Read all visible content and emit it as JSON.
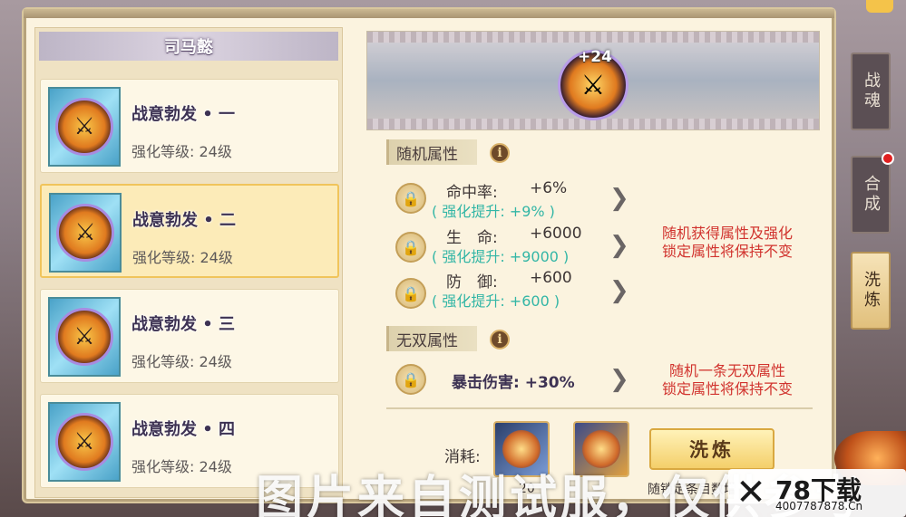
{
  "hero_name": "司马懿",
  "cards": [
    {
      "title": "战意勃发 • 一",
      "level": "强化等级: 24级",
      "selected": false
    },
    {
      "title": "战意勃发 • 二",
      "level": "强化等级: 24级",
      "selected": true
    },
    {
      "title": "战意勃发 • 三",
      "level": "强化等级: 24级",
      "selected": false
    },
    {
      "title": "战意勃发 • 四",
      "level": "强化等级: 24级",
      "selected": false
    }
  ],
  "banner_badge": "+24",
  "random_section": {
    "header": "随机属性",
    "info_icon": "i",
    "attributes": [
      {
        "name": "命中率:",
        "value": "+6%",
        "boost": "( 强化提升: +9% )"
      },
      {
        "name": "生　命:",
        "value": "+6000",
        "boost": "( 强化提升: +9000 )"
      },
      {
        "name": "防　御:",
        "value": "+600",
        "boost": "( 强化提升: +600 )"
      }
    ],
    "note_line1": "随机获得属性及强化",
    "note_line2": "锁定属性将保持不变"
  },
  "unique_section": {
    "header": "无双属性",
    "info_icon": "i",
    "attribute": "暴击伤害: +30%",
    "note_line1": "随机一条无双属性",
    "note_line2": "锁定属性将保持不变"
  },
  "cost": {
    "label": "消耗:",
    "count": "20",
    "button": "洗炼",
    "tip": "随锁定条目数增"
  },
  "side_tabs": [
    {
      "label": "战魂",
      "active": false
    },
    {
      "label": "合成",
      "active": false,
      "badge": true
    },
    {
      "label": "洗炼",
      "active": true
    }
  ],
  "watermark": "图片来自测试服，仅供参考",
  "site_logo": {
    "mark": "✕",
    "name": "78下载",
    "url": "4007787878.Cn"
  },
  "icons": {
    "lock": "lock-icon",
    "arrow": "chevron-right-icon",
    "medal": "warrior-medal-icon"
  },
  "colors": {
    "boost_text": "#33b6a6",
    "note_text": "#d1332e",
    "selected_card": "#fcebb8"
  }
}
